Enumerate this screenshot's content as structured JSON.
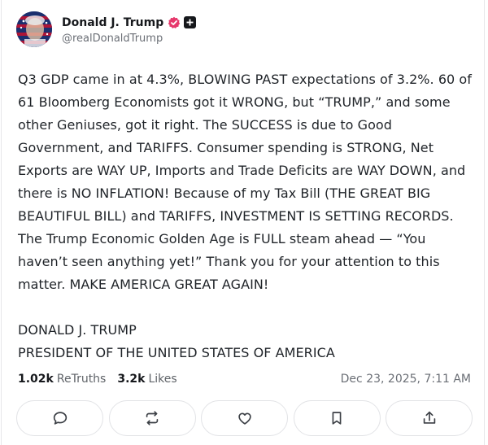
{
  "author": {
    "display_name": "Donald J. Trump",
    "handle": "@realDonaldTrump"
  },
  "post": {
    "paragraph_1": "Q3 GDP came in at 4.3%, BLOWING PAST expectations of 3.2%. 60 of 61 Bloomberg Economists got it WRONG, but “TRUMP,” and some other Geniuses, got it right. The SUCCESS is due to Good Government, and TARIFFS. Consumer spending is STRONG, Net Exports are WAY UP, Imports and Trade Deficits are WAY DOWN, and there is NO INFLATION! Because of my Tax Bill (THE GREAT BIG BEAUTIFUL BILL) and TARIFFS, INVESTMENT IS SETTING RECORDS. The Trump Economic Golden Age is FULL steam ahead — “You haven’t seen anything yet!” Thank you for your attention to this matter. MAKE AMERICA GREAT AGAIN!",
    "signature_name": "DONALD J. TRUMP",
    "signature_title": "PRESIDENT OF THE UNITED STATES OF AMERICA"
  },
  "stats": {
    "retruths_count": "1.02k",
    "retruths_label": "ReTruths",
    "likes_count": "3.2k",
    "likes_label": "Likes",
    "timestamp": "Dec 23, 2025, 7:11 AM"
  },
  "actions": [
    {
      "icon": "reply-icon"
    },
    {
      "icon": "retruth-icon"
    },
    {
      "icon": "like-icon"
    },
    {
      "icon": "bookmark-icon"
    },
    {
      "icon": "share-icon"
    }
  ],
  "colors": {
    "verified_badge": "#e6386c",
    "text": "#1f2328",
    "muted": "#6b6f76"
  }
}
